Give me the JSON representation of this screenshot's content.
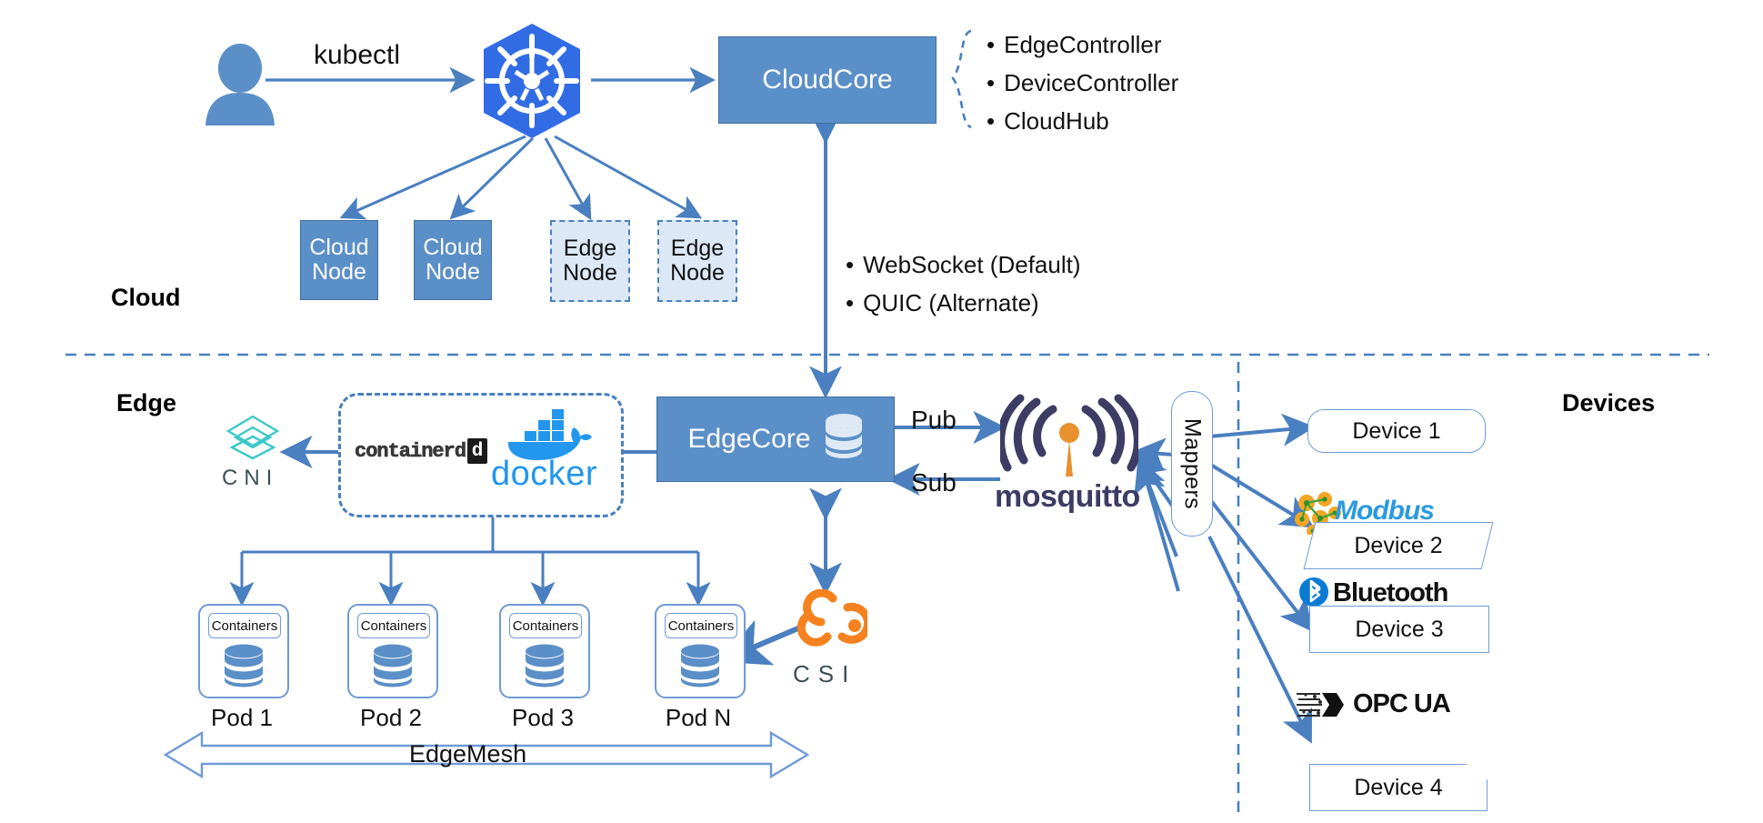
{
  "zones": {
    "cloud_label": "Cloud",
    "edge_label": "Edge",
    "devices_label": "Devices"
  },
  "cloud": {
    "user_icon": "user-silhouette-icon",
    "kubectl_label": "kubectl",
    "k8s_icon": "kubernetes-helm-wheel-icon",
    "cloudcore_label": "CloudCore",
    "cloudcore_components": [
      "EdgeController",
      "DeviceController",
      "CloudHub"
    ],
    "nodes": [
      {
        "line1": "Cloud",
        "line2": "Node",
        "style": "solid"
      },
      {
        "line1": "Cloud",
        "line2": "Node",
        "style": "solid"
      },
      {
        "line1": "Edge",
        "line2": "Node",
        "style": "dashed"
      },
      {
        "line1": "Edge",
        "line2": "Node",
        "style": "dashed"
      }
    ]
  },
  "link": {
    "protocols": [
      "WebSocket (Default)",
      "QUIC (Alternate)"
    ]
  },
  "edge": {
    "edgecore_label": "EdgeCore",
    "edgecore_db_icon": "database-cylinder-icon",
    "cni_label": "CNI",
    "cni_icon": "cni-diamond-icon",
    "containerd_label": "containerd",
    "containerd_badge": "d",
    "docker_label": "docker",
    "docker_icon": "docker-whale-icon",
    "csi_label": "CSI",
    "csi_icon": "csi-trilobe-icon",
    "pods": [
      {
        "tag": "Containers",
        "label": "Pod 1",
        "icon": "database-cylinder-icon"
      },
      {
        "tag": "Containers",
        "label": "Pod 2",
        "icon": "database-cylinder-icon"
      },
      {
        "tag": "Containers",
        "label": "Pod 3",
        "icon": "database-cylinder-icon"
      },
      {
        "tag": "Containers",
        "label": "Pod N",
        "icon": "database-cylinder-icon"
      }
    ],
    "edgemesh_label": "EdgeMesh"
  },
  "broker": {
    "pub_label": "Pub",
    "sub_label": "Sub",
    "mosquitto_label": "mosquitto",
    "mosquitto_icon": "mosquitto-signal-icon",
    "mappers_label": "Mappers"
  },
  "devices": [
    {
      "label": "Device 1",
      "protocol": "",
      "shape": "rounded",
      "logo_icon": ""
    },
    {
      "label": "Device 2",
      "protocol": "Modbus",
      "shape": "parallelogram",
      "logo_icon": "modbus-logo-icon"
    },
    {
      "label": "Device 3",
      "protocol": "Bluetooth",
      "shape": "rect",
      "logo_icon": "bluetooth-logo-icon"
    },
    {
      "label": "Device 4",
      "protocol": "OPC UA",
      "shape": "clipped",
      "logo_icon": "opcua-logo-icon"
    }
  ],
  "colors": {
    "node_blue": "#5b8fc7",
    "node_border": "#3f6fa3",
    "edge_node_fill": "#dce8f5",
    "arrow_blue": "#4a7fc0",
    "k8s_blue": "#326ce5",
    "docker_blue": "#2396ed",
    "csi_orange": "#f5821f",
    "mosquitto_navy": "#3c3c64",
    "mosquitto_orange": "#e8912d",
    "cni_teal": "#3ec8c8",
    "modbus_blue": "#2b9ade",
    "bluetooth_blue": "#0a7bd4",
    "divider_blue": "#4a7fc0"
  }
}
